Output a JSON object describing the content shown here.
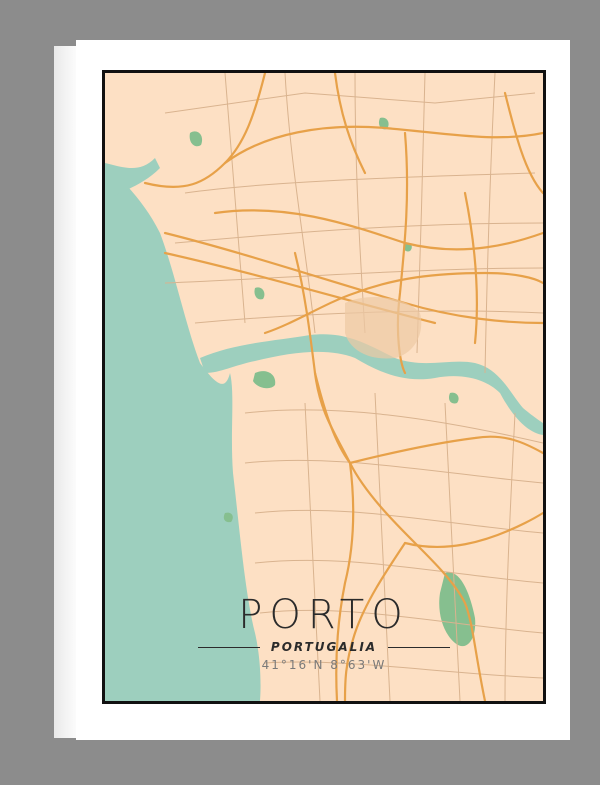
{
  "map": {
    "city": "PORTO",
    "country": "PORTUGALIA",
    "coordinates": "41°16'N 8°63'W",
    "colors": {
      "land": "#fde0c4",
      "water": "#9dcfbe",
      "road_major": "#e7a149",
      "road_minor": "#d9b38f",
      "park": "#86bf8f",
      "frame": "#111111",
      "canvas_bg": "#8c8c8c"
    }
  }
}
